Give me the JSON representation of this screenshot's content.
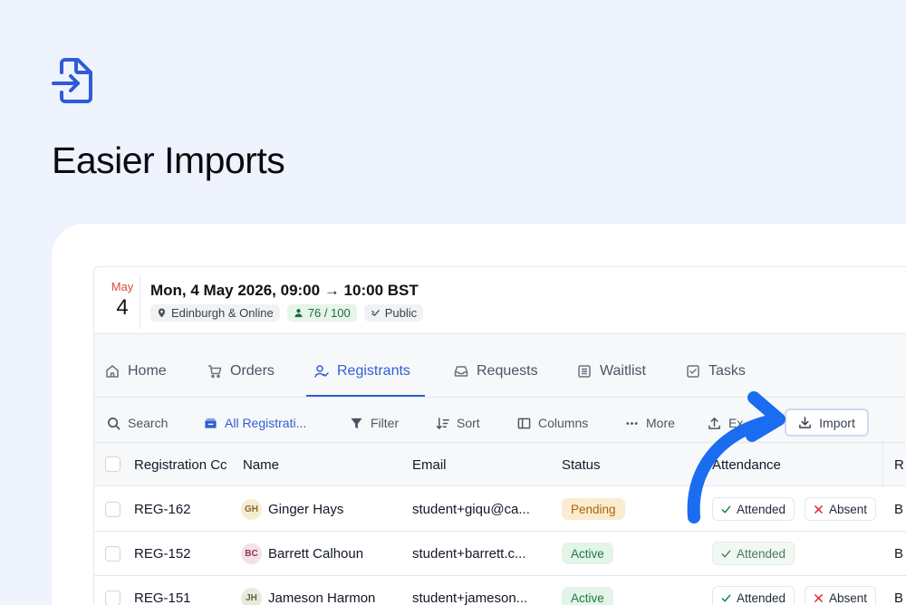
{
  "hero": {
    "title": "Easier Imports",
    "icon": "file-import-icon"
  },
  "event": {
    "month": "May",
    "day": "4",
    "title": "Mon, 4 May 2026, 09:00 → 10:00 BST",
    "location": "Edinburgh & Online",
    "capacity": "76 / 100",
    "visibility": "Public"
  },
  "tabs": [
    {
      "label": "Home",
      "icon": "home-icon"
    },
    {
      "label": "Orders",
      "icon": "cart-icon"
    },
    {
      "label": "Registrants",
      "icon": "user-check-icon",
      "active": true
    },
    {
      "label": "Requests",
      "icon": "inbox-icon"
    },
    {
      "label": "Waitlist",
      "icon": "list-icon"
    },
    {
      "label": "Tasks",
      "icon": "checkbox-icon"
    }
  ],
  "toolbar": {
    "search": "Search",
    "view": "All Registrati...",
    "filter": "Filter",
    "sort": "Sort",
    "columns": "Columns",
    "more": "More",
    "export": "Ex",
    "import": "Import"
  },
  "table": {
    "headers": [
      "Registration Cc",
      "Name",
      "Email",
      "Status",
      "Attendance",
      "R"
    ],
    "rows": [
      {
        "code": "REG-162",
        "initials": "GH",
        "name": "Ginger Hays",
        "email": "student+giqu@ca...",
        "status": "Pending",
        "attended": "Attended",
        "absent": "Absent",
        "extra": "B"
      },
      {
        "code": "REG-152",
        "initials": "BC",
        "name": "Barrett Calhoun",
        "email": "student+barrett.c...",
        "status": "Active",
        "attended": "Attended",
        "absent": "",
        "extra": "B"
      },
      {
        "code": "REG-151",
        "initials": "JH",
        "name": "Jameson Harmon",
        "email": "student+jameson...",
        "status": "Active",
        "attended": "Attended",
        "absent": "Absent",
        "extra": "B"
      }
    ]
  },
  "colors": {
    "accent": "#2f5fd0",
    "arrow": "#1a6cf0",
    "background": "#eef3fd"
  }
}
